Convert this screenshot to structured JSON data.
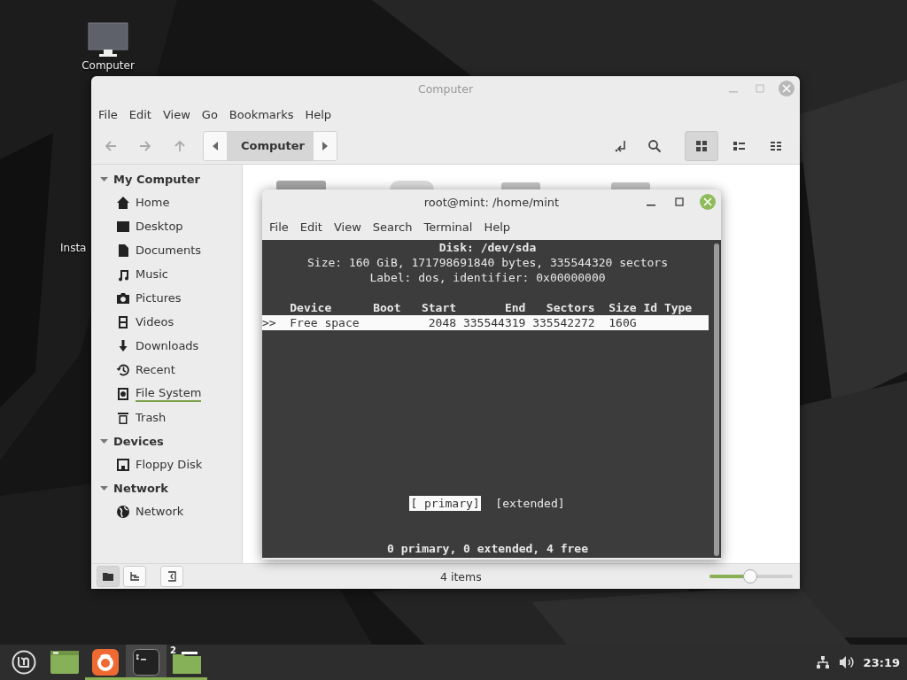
{
  "desktop_icons": [
    {
      "label": "Computer",
      "kind": "computer"
    },
    {
      "label": "Insta",
      "kind": "installer"
    }
  ],
  "file_manager": {
    "title": "Computer",
    "menu": [
      "File",
      "Edit",
      "View",
      "Go",
      "Bookmarks",
      "Help"
    ],
    "path": "Computer",
    "view_modes": [
      {
        "selected": true
      },
      {
        "selected": false
      },
      {
        "selected": false
      }
    ],
    "sidebar": [
      {
        "heading": "My Computer",
        "expanded": true,
        "items": [
          {
            "label": "Home"
          },
          {
            "label": "Desktop"
          },
          {
            "label": "Documents"
          },
          {
            "label": "Music"
          },
          {
            "label": "Pictures"
          },
          {
            "label": "Videos"
          },
          {
            "label": "Downloads"
          },
          {
            "label": "Recent"
          },
          {
            "label": "File System",
            "level": 1
          },
          {
            "label": "Trash"
          }
        ]
      },
      {
        "heading": "Devices",
        "expanded": true,
        "items": [
          {
            "label": "Floppy Disk"
          }
        ]
      },
      {
        "heading": "Network",
        "expanded": true,
        "items": [
          {
            "label": "Network"
          }
        ]
      }
    ],
    "sidebar_modes": [
      {
        "selected": true
      },
      {
        "selected": false
      }
    ],
    "status": "4 items",
    "zoom": {
      "level": 0.49
    }
  },
  "terminal": {
    "title": "root@mint: /home/mint",
    "menu": [
      "File",
      "Edit",
      "View",
      "Search",
      "Terminal",
      "Help"
    ],
    "lines": [
      {
        "kind": "title",
        "text": "Disk: /dev/sda"
      },
      {
        "kind": "info",
        "text": "Size: 160 GiB, 171798691840 bytes, 335544320 sectors"
      },
      {
        "kind": "info",
        "text": "Label: dos, identifier: 0x00000000"
      }
    ],
    "columns": [
      "Device",
      "Boot",
      "Start",
      "End",
      "Sectors",
      "Size",
      "Id",
      "Type"
    ],
    "rows": [
      {
        "selected": true,
        "marker": ">>",
        "device": "Free space",
        "start": "2048",
        "end": "335544319",
        "sectors": "335542272",
        "size": "160G"
      }
    ],
    "buttons": [
      {
        "label": "[ primary]",
        "selected": true
      },
      {
        "label": "[extended]",
        "selected": false
      }
    ],
    "status": "0 primary, 0 extended, 4 free"
  },
  "taskbar": {
    "apps": [
      {
        "kind": "menu",
        "running": false,
        "active": false
      },
      {
        "kind": "desktop",
        "running": false,
        "active": false
      },
      {
        "kind": "browser",
        "running": true,
        "active": false
      },
      {
        "kind": "terminal",
        "running": true,
        "active": true
      },
      {
        "kind": "folder",
        "running": true,
        "active": false,
        "badge": "2"
      }
    ],
    "clock": "23:19"
  }
}
